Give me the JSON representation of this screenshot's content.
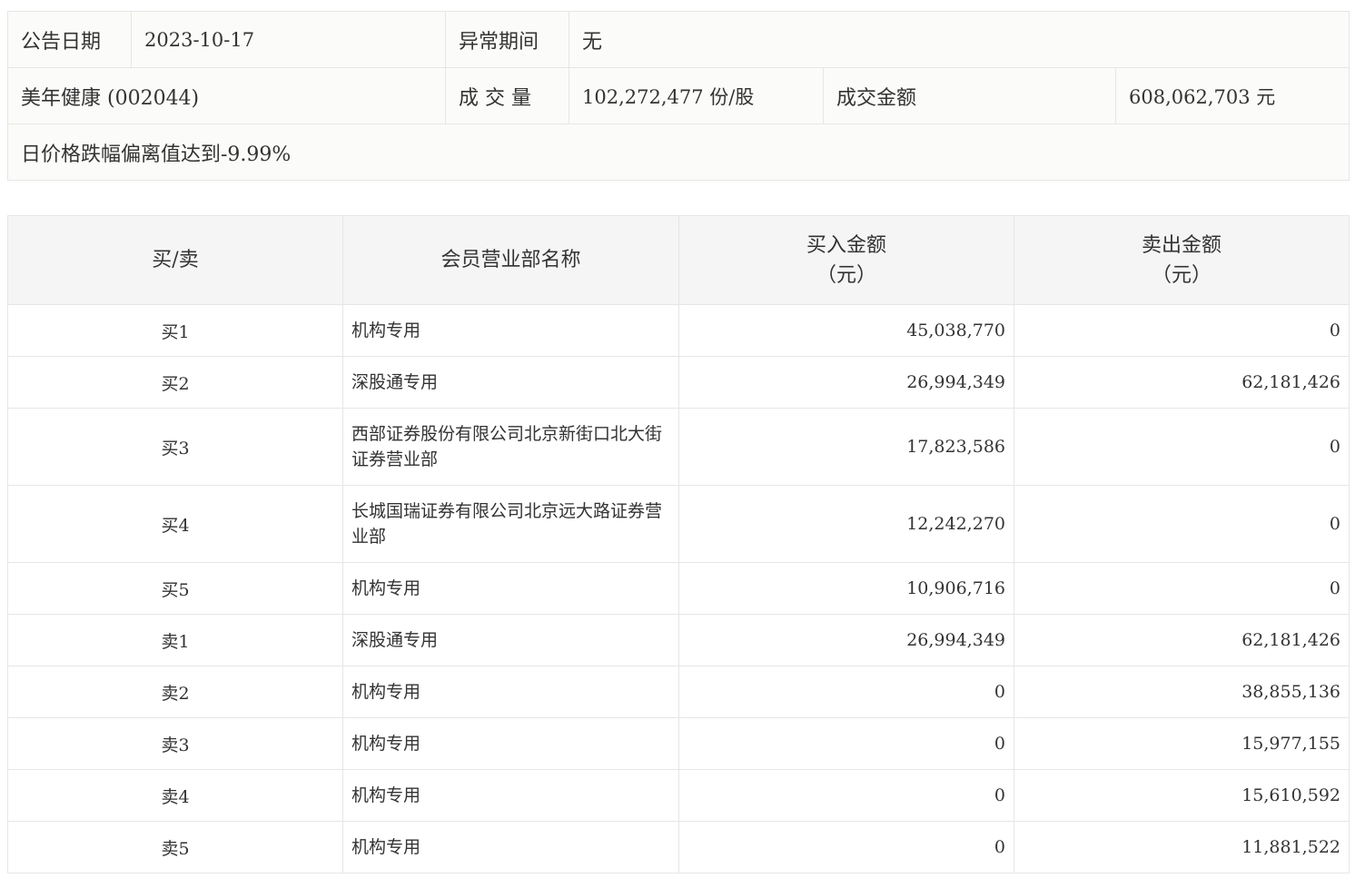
{
  "info": {
    "date_label": "公告日期",
    "date_value": "2023-10-17",
    "abnormal_label": "异常期间",
    "abnormal_value": "无",
    "stock": "美年健康 (002044)",
    "volume_label": "成 交 量",
    "volume_value": "102,272,477 份/股",
    "turnover_label": "成交金额",
    "turnover_value": "608,062,703 元",
    "reason": "日价格跌幅偏离值达到-9.99%"
  },
  "table": {
    "headers": {
      "side": "买/卖",
      "member": "会员营业部名称",
      "buy_line1": "买入金额",
      "buy_line2": "（元）",
      "sell_line1": "卖出金额",
      "sell_line2": "（元）"
    },
    "rows": [
      {
        "side": "买1",
        "name": "机构专用",
        "buy": "45,038,770",
        "sell": "0"
      },
      {
        "side": "买2",
        "name": "深股通专用",
        "buy": "26,994,349",
        "sell": "62,181,426"
      },
      {
        "side": "买3",
        "name": "西部证券股份有限公司北京新街口北大街证券营业部",
        "buy": "17,823,586",
        "sell": "0"
      },
      {
        "side": "买4",
        "name": "长城国瑞证券有限公司北京远大路证券营业部",
        "buy": "12,242,270",
        "sell": "0"
      },
      {
        "side": "买5",
        "name": "机构专用",
        "buy": "10,906,716",
        "sell": "0"
      },
      {
        "side": "卖1",
        "name": "深股通专用",
        "buy": "26,994,349",
        "sell": "62,181,426"
      },
      {
        "side": "卖2",
        "name": "机构专用",
        "buy": "0",
        "sell": "38,855,136"
      },
      {
        "side": "卖3",
        "name": "机构专用",
        "buy": "0",
        "sell": "15,977,155"
      },
      {
        "side": "卖4",
        "name": "机构专用",
        "buy": "0",
        "sell": "15,610,592"
      },
      {
        "side": "卖5",
        "name": "机构专用",
        "buy": "0",
        "sell": "11,881,522"
      }
    ]
  }
}
